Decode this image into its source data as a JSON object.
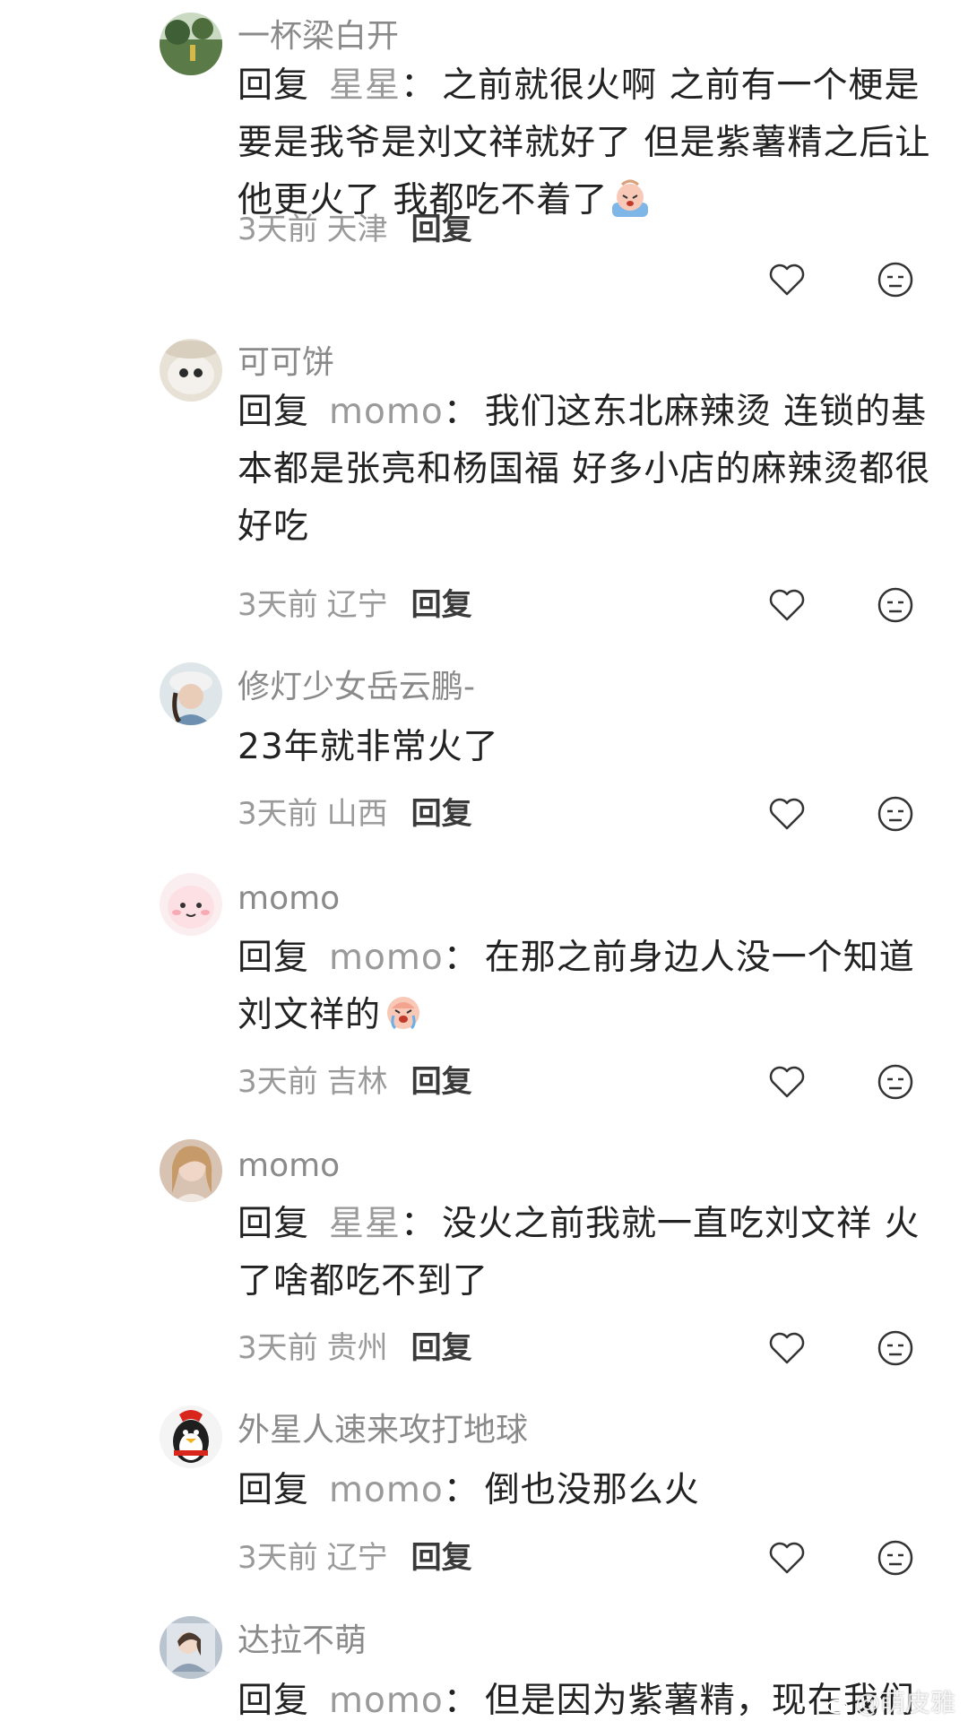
{
  "comments": [
    {
      "username": "一杯梁白开",
      "reply_word": "回复",
      "reply_to": "星星",
      "colon": "：",
      "text": "之前就很火啊 之前有一个梗是要是我爷是刘文祥就好了 但是紫薯精之后让他更火了 我都吃不着了",
      "emoji": "crying-emoji",
      "time": "3天前",
      "location": "天津",
      "reply_label": "回复"
    },
    {
      "username": "可可饼",
      "reply_word": "回复",
      "reply_to": "momo",
      "colon": "：",
      "text": "我们这东北麻辣烫 连锁的基本都是张亮和杨国福 好多小店的麻辣烫都很好吃",
      "time": "3天前",
      "location": "辽宁",
      "reply_label": "回复"
    },
    {
      "username": "修灯少女岳云鹏-",
      "text": "23年就非常火了",
      "time": "3天前",
      "location": "山西",
      "reply_label": "回复"
    },
    {
      "username": "momo",
      "reply_word": "回复",
      "reply_to": "momo",
      "colon": "：",
      "text": "在那之前身边人没一个知道刘文祥的",
      "emoji": "crying-emoji",
      "time": "3天前",
      "location": "吉林",
      "reply_label": "回复"
    },
    {
      "username": "momo",
      "reply_word": "回复",
      "reply_to": "星星",
      "colon": "：",
      "text": "没火之前我就一直吃刘文祥 火了啥都吃不到了",
      "time": "3天前",
      "location": "贵州",
      "reply_label": "回复"
    },
    {
      "username": "外星人速来攻打地球",
      "reply_word": "回复",
      "reply_to": "momo",
      "colon": "：",
      "text": "倒也没那么火",
      "time": "3天前",
      "location": "辽宁",
      "reply_label": "回复"
    },
    {
      "username": "达拉不萌",
      "reply_word": "回复",
      "reply_to": "momo",
      "colon": "：",
      "text": "但是因为紫薯精，现在我们"
    }
  ],
  "icons": {
    "like": "heart-outline-icon",
    "dislike": "neutral-face-icon"
  },
  "colors": {
    "username": "#8a8a8a",
    "body_text": "#222222",
    "reply_target": "#9a9a9a",
    "meta": "#9a9a9a",
    "reply_button": "#3a3a3a"
  },
  "watermark": {
    "text": "@萌皮雅"
  }
}
